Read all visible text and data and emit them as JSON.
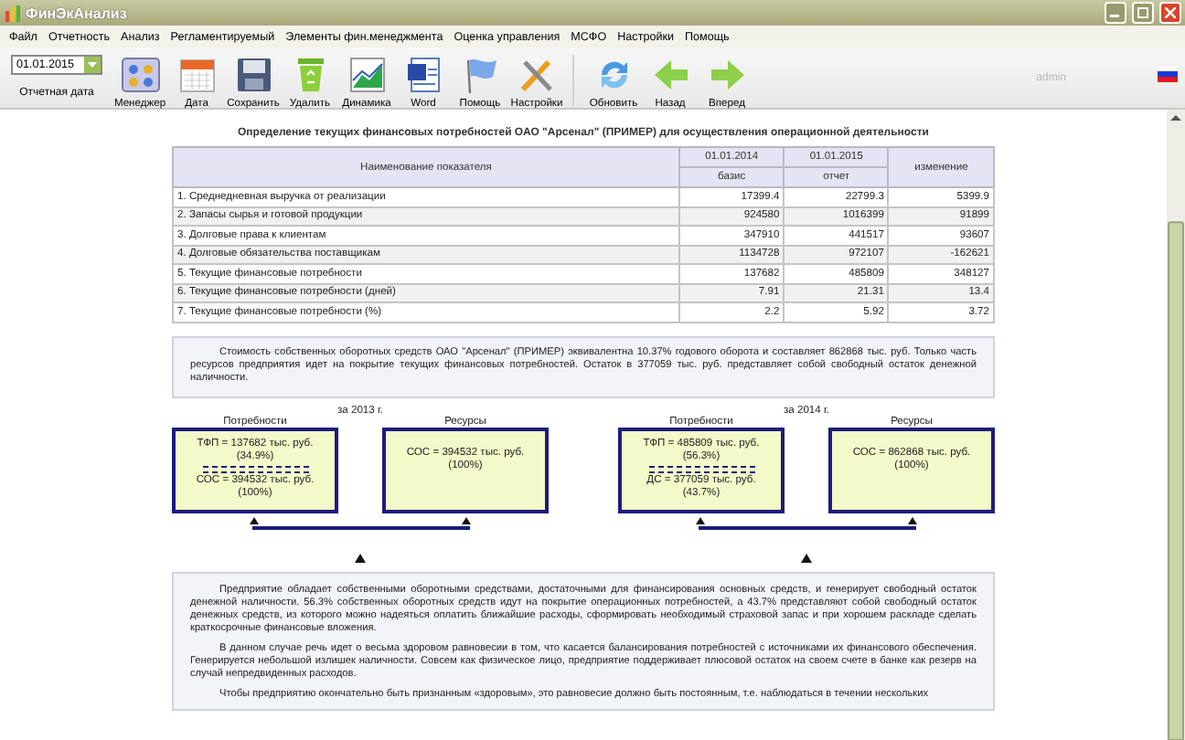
{
  "window": {
    "title": "ФинЭкАнализ"
  },
  "menu": [
    "Файл",
    "Отчетность",
    "Анализ",
    "Регламентируемый",
    "Элементы фин.менеджмента",
    "Оценка управления",
    "МСФО",
    "Настройки",
    "Помощь"
  ],
  "date_picker": {
    "value": "01.01.2015",
    "label": "Отчетная дата"
  },
  "toolbar": [
    {
      "label": "Менеджер",
      "kind": "manager"
    },
    {
      "label": "Дата",
      "kind": "calendar"
    },
    {
      "label": "Сохранить",
      "kind": "save"
    },
    {
      "label": "Удалить",
      "kind": "recycle"
    },
    {
      "label": "Динамика",
      "kind": "chart"
    },
    {
      "label": "Word",
      "kind": "word"
    },
    {
      "label": "Помощь",
      "kind": "flag"
    },
    {
      "label": "Настройки",
      "kind": "tools"
    },
    {
      "label": "Обновить",
      "kind": "refresh",
      "group_start": true
    },
    {
      "label": "Назад",
      "kind": "back"
    },
    {
      "label": "Вперед",
      "kind": "forward"
    }
  ],
  "user": "admin",
  "report": {
    "title": "Определение текущих финансовых потребностей ОАО \"Арсенал\" (ПРИМЕР) для осуществления операционной деятельности",
    "columns": [
      {
        "label": "Наименование показателя"
      },
      {
        "label": "01.01.2014",
        "sub": "базис"
      },
      {
        "label": "01.01.2015",
        "sub": "отчет"
      },
      {
        "label": "изменение"
      }
    ],
    "rows": [
      [
        "1. Среднедневная выручка от реализации",
        "17399.4",
        "22799.3",
        "5399.9"
      ],
      [
        "2. Запасы сырья и готовой продукции",
        "924580",
        "1016399",
        "91899"
      ],
      [
        "3. Долговые права к клиентам",
        "347910",
        "441517",
        "93607"
      ],
      [
        "4. Долговые обязательства поставщикам",
        "1134728",
        "972107",
        "-162621"
      ],
      [
        "5. Текущие финансовые потребности",
        "137682",
        "485809",
        "348127"
      ],
      [
        "6. Текущие финансовые потребности (дней)",
        "7.91",
        "21.31",
        "13.4"
      ],
      [
        "7. Текущие финансовые потребности (%)",
        "2.2",
        "5.92",
        "3.72"
      ]
    ],
    "note": "Стоимость собственных оборотных средств ОАО \"Арсенал\" (ПРИМЕР) эквивалентна 10.37% годового оборота и составляет 862868 тыс. руб. Только часть ресурсов предприятия идет на покрытие текущих финансовых потребностей. Остаток в 377059 тыс. руб. представляет собой свободный остаток денежной наличности.",
    "balances": [
      {
        "year": "за 2013 г.",
        "needs_label": "Потребности",
        "needs_top": [
          "ТФП = 137682 тыс. руб.",
          "(34.9%)"
        ],
        "needs_bottom": [
          "СОС = 394532 тыс. руб.",
          "(100%)"
        ],
        "resources_label": "Ресурсы",
        "resources": [
          "СОС = 394532 тыс. руб.",
          "(100%)"
        ]
      },
      {
        "year": "за 2014 г.",
        "needs_label": "Потребности",
        "needs_top": [
          "ТФП = 485809 тыс. руб.",
          "(56.3%)"
        ],
        "needs_bottom": [
          "ДС = 377059 тыс. руб.",
          "(43.7%)"
        ],
        "resources_label": "Ресурсы",
        "resources": [
          "СОС = 862868 тыс. руб.",
          "(100%)"
        ]
      }
    ],
    "analysis": [
      "Предприятие обладает собственными оборотными средствами, достаточными для финансирования основных средств, и генерирует свободный остаток денежной наличности. 56.3% собственных оборотных средств идут на покрытие операционных потребностей, а 43.7% представляют собой свободный остаток денежных средств, из которого можно надеяться оплатить ближайшие расходы, сформировать необходимый страховой запас и при хорошем раскладе сделать краткосрочные финансовые вложения.",
      "В данном случае речь идет о весьма здоровом равновесии в том, что касается балансирования потребностей с источниками их финансового обеспечения. Генерируется небольшой излишек наличности. Совсем как физическое лицо, предприятие поддерживает плюсовой остаток на своем счете в банке как резерв на случай непредвиденных расходов.",
      "Чтобы предприятию окончательно быть признанным «здоровым», это равновесие должно быть постоянным, т.е. наблюдаться в течении нескольких"
    ]
  }
}
